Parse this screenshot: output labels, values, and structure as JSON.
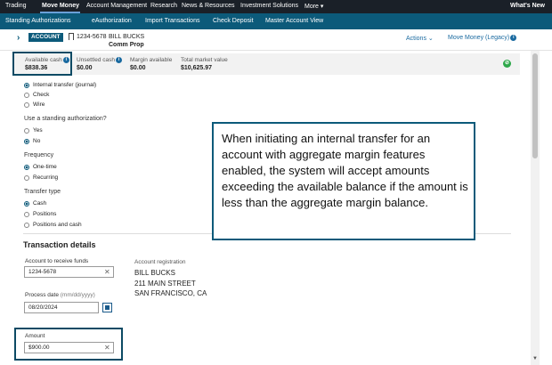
{
  "topnav": {
    "items": [
      "Trading",
      "Move Money",
      "Account Management",
      "Research",
      "News & Resources",
      "Investment Solutions",
      "More"
    ],
    "more_caret": "▾",
    "whats_new": "What's New"
  },
  "subnav": {
    "items": [
      "Standing Authorizations",
      "eAuthorization",
      "Import Transactions",
      "Check Deposit",
      "Master Account View"
    ]
  },
  "account": {
    "badge": "ACCOUNT",
    "number": "1234-5678",
    "name": "BILL BUCKS",
    "type": "Comm Prop",
    "actions": "Actions ⌄",
    "move_money": "Move Money (Legacy)"
  },
  "balances": [
    {
      "label": "Available cash",
      "value": "$838.36"
    },
    {
      "label": "Unsettled cash",
      "value": "$0.00"
    },
    {
      "label": "Margin available",
      "value": "$0.00"
    },
    {
      "label": "Total market value",
      "value": "$10,625.97"
    }
  ],
  "form": {
    "method_options": [
      "Internal transfer (journal)",
      "Check",
      "Wire"
    ],
    "standing_label": "Use a standing authorization?",
    "standing_options": [
      "Yes",
      "No"
    ],
    "frequency_label": "Frequency",
    "frequency_options": [
      "One-time",
      "Recurring"
    ],
    "transfer_type_label": "Transfer type",
    "transfer_type_options": [
      "Cash",
      "Positions",
      "Positions and cash"
    ],
    "section_title": "Transaction details",
    "receive_label": "Account to receive funds",
    "receive_value": "1234-5678",
    "process_date_label": "Process date",
    "process_date_hint": "(mm/dd/yyyy)",
    "process_date_value": "08/20/2024",
    "amount_label": "Amount",
    "amount_value": "$900.00",
    "registration_label": "Account registration",
    "registration_lines": [
      "BILL BUCKS",
      "211 MAIN STREET",
      "SAN FRANCISCO, CA"
    ]
  },
  "callout": {
    "text": "When initiating an internal transfer for an account with aggregate margin features enabled, the system will accept amounts exceeding the available balance if the amount is less than the aggregate margin balance."
  },
  "icons": {
    "info": "i",
    "clear": "✕",
    "green_status": "⊘",
    "chevron": "›",
    "scroll_down": "▼"
  },
  "colors": {
    "topnav_bg": "#1a2028",
    "subnav_bg": "#0c5a7a",
    "highlight_border": "#0c4a64",
    "link": "#1a6aa0",
    "status_green": "#2ea84a"
  }
}
